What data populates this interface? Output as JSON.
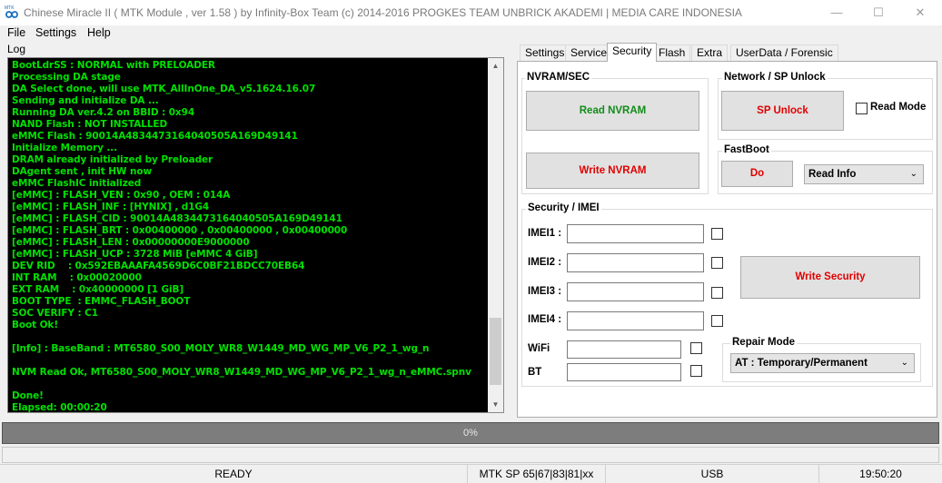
{
  "window": {
    "title": "Chinese Miracle II ( MTK Module , ver 1.58 ) by Infinity-Box Team (c) 2014-2016  PROGKES TEAM UNBRICK AKADEMI | MEDIA CARE INDONESIA",
    "icon": "infinity-logo-icon"
  },
  "menu": [
    "File",
    "Settings",
    "Help"
  ],
  "log": {
    "label": "Log",
    "lines": [
      "BootLdrSS : NORMAL with PRELOADER",
      "Processing DA stage",
      "DA Select done, will use MTK_AllInOne_DA_v5.1624.16.07",
      "Sending and initialize DA ...",
      "Running DA ver.4.2 on BBID : 0x94",
      "NAND Flash : NOT INSTALLED",
      "eMMC Flash : 90014A4834473164040505A169D49141",
      "Initialize Memory ...",
      "DRAM already initialized by Preloader",
      "DAgent sent , init HW now",
      "eMMC FlashIC initialized",
      "[eMMC] : FLASH_VEN : 0x90 , OEM : 014A",
      "[eMMC] : FLASH_INF : [HYNIX] , d1G4",
      "[eMMC] : FLASH_CID : 90014A4834473164040505A169D49141",
      "[eMMC] : FLASH_BRT : 0x00400000 , 0x00400000 , 0x00400000",
      "[eMMC] : FLASH_LEN : 0x00000000E9000000",
      "[eMMC] : FLASH_UCP : 3728 MiB [eMMC 4 GiB]",
      "DEV RID    : 0x592EBAAAFA4569D6C0BF21BDCC70EB64",
      "INT RAM    : 0x00020000",
      "EXT RAM    : 0x40000000 [1 GiB]",
      "BOOT TYPE  : EMMC_FLASH_BOOT",
      "SOC VERIFY : C1",
      "Boot Ok!",
      "",
      "[Info] : BaseBand : MT6580_S00_MOLY_WR8_W1449_MD_WG_MP_V6_P2_1_wg_n",
      "",
      "NVM Read Ok, MT6580_S00_MOLY_WR8_W1449_MD_WG_MP_V6_P2_1_wg_n_eMMC.spnv",
      "",
      "Done!",
      "Elapsed: 00:00:20"
    ]
  },
  "tabs": [
    "Settings",
    "Service",
    "Security",
    "Flash",
    "Extra",
    "UserData / Forensic"
  ],
  "active_tab": "Security",
  "security": {
    "nvram_group": "NVRAM/SEC",
    "read_nvram": "Read NVRAM",
    "write_nvram": "Write NVRAM",
    "network_group": "Network / SP Unlock",
    "sp_unlock": "SP Unlock",
    "read_mode": "Read Mode",
    "fastboot_group": "FastBoot",
    "do": "Do",
    "fastboot_option": "Read Info",
    "imei_group": "Security / IMEI",
    "imei1": "IMEI1 :",
    "imei2": "IMEI2 :",
    "imei3": "IMEI3 :",
    "imei4": "IMEI4 :",
    "wifi": "WiFi",
    "bt": "BT",
    "colon": ":",
    "write_security": "Write Security",
    "repair_group": "Repair Mode",
    "repair_option": "AT  : Temporary/Permanent"
  },
  "progress": {
    "text": "0%",
    "value": 0
  },
  "status": {
    "state": "READY",
    "device": "MTK SP 65|67|83|81|xx",
    "port": "USB",
    "time": "19:50:20"
  },
  "colors": {
    "log_text": "#00e000",
    "accent_green": "#118c18",
    "accent_red": "#e00000",
    "progress_bg": "#7d7d7d"
  }
}
